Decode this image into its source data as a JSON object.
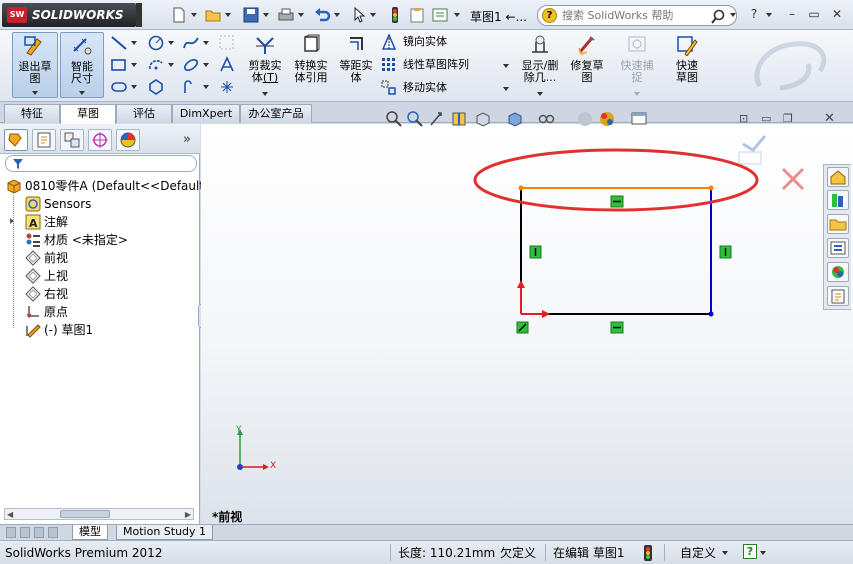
{
  "app": {
    "name": "SOLIDWORKS",
    "badge": "SW"
  },
  "title_bar": {
    "document_title": "草图1 ←...",
    "help_search": {
      "placeholder": "搜索 SolidWorks 帮助",
      "help_icon": "?"
    },
    "window_buttons": {
      "help": "?",
      "minimize": "–",
      "restore": "▭",
      "close": "✕"
    }
  },
  "ribbon": {
    "buttons": [
      {
        "label": "退出草图",
        "icon": "exit-sketch-icon"
      },
      {
        "label": "智能尺寸",
        "icon": "smart-dimension-icon"
      },
      {
        "label": "剪裁实体",
        "shortcut": "(T)",
        "icon": "trim-entities-icon"
      },
      {
        "label": "转换实体引用",
        "icon": "convert-entities-icon"
      },
      {
        "label": "等距实体",
        "icon": "offset-entities-icon"
      },
      {
        "label": "显示/删除几...",
        "icon": "display-relations-icon"
      },
      {
        "label": "修复草图",
        "icon": "repair-sketch-icon"
      },
      {
        "label": "快速捕捉",
        "icon": "quick-snaps-icon",
        "disabled": true
      },
      {
        "label": "快速草图",
        "icon": "rapid-sketch-icon"
      }
    ],
    "list_tools": [
      {
        "label": "镜向实体",
        "icon": "mirror-entities-icon"
      },
      {
        "label": "线性草图阵列",
        "icon": "linear-pattern-icon"
      },
      {
        "label": "移动实体",
        "icon": "move-entities-icon"
      }
    ]
  },
  "tabs": [
    {
      "label": "特征",
      "active": false
    },
    {
      "label": "草图",
      "active": true
    },
    {
      "label": "评估",
      "active": false
    },
    {
      "label": "DimXpert",
      "active": false
    },
    {
      "label": "办公室产品",
      "active": false
    }
  ],
  "feature_tree": {
    "items": [
      {
        "label": "0810零件A  (Default<<Default",
        "icon": "part-icon"
      },
      {
        "label": "Sensors",
        "icon": "sensors-icon"
      },
      {
        "label": "注解",
        "icon": "annotations-icon"
      },
      {
        "label": "材质 <未指定>",
        "icon": "material-icon"
      },
      {
        "label": "前视",
        "icon": "plane-icon"
      },
      {
        "label": "上视",
        "icon": "plane-icon"
      },
      {
        "label": "右视",
        "icon": "plane-icon"
      },
      {
        "label": "原点",
        "icon": "origin-icon"
      },
      {
        "label": "(-) 草图1",
        "icon": "sketch-icon"
      }
    ]
  },
  "graphics": {
    "view_label": "*前视",
    "triad": {
      "x": "X",
      "y": "Y"
    },
    "highlight_color": "#e03030",
    "sketch_colors": {
      "selected_edge": "#ff8000",
      "constrained": "#000000",
      "unconstrained": "#0000cc",
      "relation": "#2fbf3a"
    }
  },
  "model_tabs": [
    {
      "label": "模型",
      "active": true
    },
    {
      "label": "Motion Study 1",
      "active": false
    }
  ],
  "status_bar": {
    "product": "SolidWorks Premium 2012",
    "length": "长度: 110.21mm",
    "definition": "欠定义",
    "editing": "在编辑 草图1",
    "units": "自定义",
    "help": "?"
  }
}
